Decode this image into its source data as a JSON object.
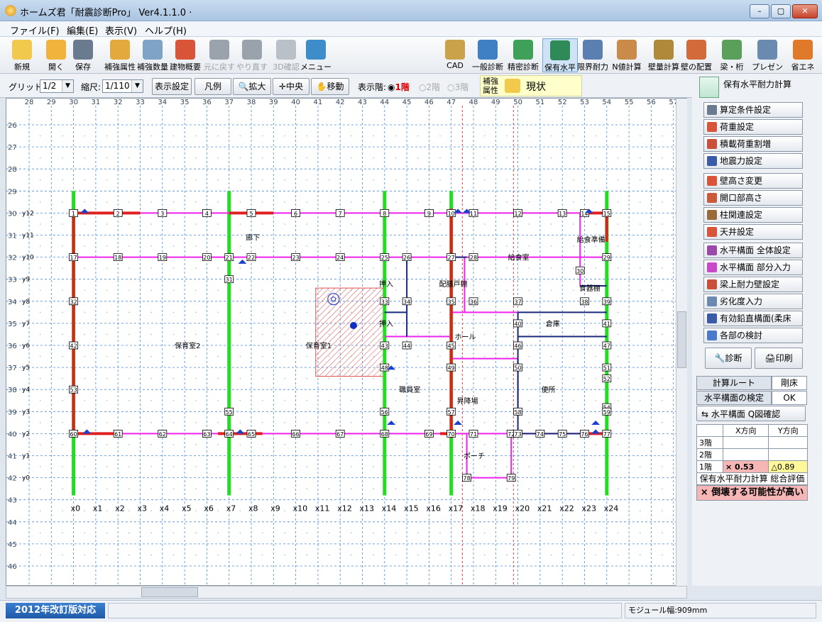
{
  "window": {
    "title": "ホームズ君「耐震診断Pro」 Ver4.1.1.0 ·",
    "controls": [
      "–",
      "▢",
      "✕"
    ]
  },
  "menu": [
    "ファイル(F)",
    "編集(E)",
    "表示(V)",
    "ヘルプ(H)"
  ],
  "toolbar_left": [
    {
      "label": "新規",
      "icon": "new-icon",
      "color": "#f2c94c"
    },
    {
      "label": "開く",
      "icon": "open-folder-icon",
      "color": "#f0b43c"
    },
    {
      "label": "保存",
      "icon": "save-icon",
      "color": "#6b7b8f"
    },
    {
      "label": "補強属性",
      "icon": "reinforce-attr-icon",
      "color": "#e4a93c"
    },
    {
      "label": "補強数量",
      "icon": "calculator-icon",
      "color": "#7fa3c4"
    },
    {
      "label": "建物概要",
      "icon": "house-icon",
      "color": "#d8553a"
    },
    {
      "label": "元に戻す",
      "icon": "undo-icon",
      "color": "#9aa2ab",
      "disabled": true
    },
    {
      "label": "やり直す",
      "icon": "redo-icon",
      "color": "#9aa2ab",
      "disabled": true
    },
    {
      "label": "3D確認",
      "icon": "3d-icon",
      "color": "#b9c0c8",
      "disabled": true
    },
    {
      "label": "メニュー",
      "icon": "menu-door-icon",
      "color": "#3c8dc9"
    }
  ],
  "toolbar_right": [
    {
      "label": "CAD",
      "icon": "cad-icon",
      "color": "#c9a24a"
    },
    {
      "label": "一般診断",
      "icon": "general-diag-icon",
      "color": "#3f7fc4"
    },
    {
      "label": "精密診断",
      "icon": "precise-diag-icon",
      "color": "#3fa05a"
    },
    {
      "label": "保有水平",
      "icon": "horizontal-capacity-icon",
      "color": "#2e8b57",
      "active": true
    },
    {
      "label": "限界耐力",
      "icon": "limit-strength-icon",
      "color": "#5a7fb0"
    },
    {
      "label": "N値計算",
      "icon": "n-value-icon",
      "color": "#c98a4a"
    },
    {
      "label": "壁量計算",
      "icon": "wall-amount-icon",
      "color": "#b08a3a"
    },
    {
      "label": "壁の配置",
      "icon": "wall-layout-icon",
      "color": "#d26a3a"
    },
    {
      "label": "梁・桁",
      "icon": "beam-icon",
      "color": "#5aa05a"
    },
    {
      "label": "プレゼン",
      "icon": "presentation-icon",
      "color": "#6a8ab0"
    },
    {
      "label": "省エネ",
      "icon": "energy-icon",
      "color": "#e07a2a"
    }
  ],
  "toolbar2": {
    "grid_label": "グリッド:",
    "grid_value": "1/2",
    "scale_label": "縮尺:",
    "scale_value": "1/110",
    "display_settings": "表示設定",
    "legend": "凡例",
    "zoom": "拡大",
    "center": "中央",
    "move": "移動",
    "floor_label": "表示階:",
    "floors": [
      "1階",
      "2階",
      "3階"
    ],
    "attr_label": "補強属性",
    "attr_value": "現状"
  },
  "grid": {
    "top_numbers": [
      "28",
      "29",
      "30",
      "31",
      "32",
      "33",
      "34",
      "35",
      "36",
      "37",
      "38",
      "39",
      "40",
      "41",
      "42",
      "43",
      "44",
      "45",
      "46",
      "47",
      "48",
      "49",
      "50",
      "51",
      "52",
      "53",
      "54",
      "55",
      "56",
      "57"
    ],
    "left_numbers": [
      "26",
      "27",
      "28",
      "29",
      "30",
      "31",
      "32",
      "33",
      "34",
      "35",
      "36",
      "37",
      "38",
      "39",
      "40",
      "41",
      "42",
      "43",
      "44",
      "45",
      "46"
    ],
    "x_labels": [
      "x0",
      "x1",
      "x2",
      "x3",
      "x4",
      "x5",
      "x6",
      "x7",
      "x8",
      "x9",
      "x10",
      "x11",
      "x12",
      "x13",
      "x14",
      "x15",
      "x16",
      "x17",
      "x18",
      "x19",
      "x20",
      "x21",
      "x22",
      "x23",
      "x24"
    ],
    "y_labels": [
      "y12",
      "y11",
      "y10",
      "y9",
      "y8",
      "y7",
      "y6",
      "y5",
      "y4",
      "y3",
      "y2",
      "y1",
      "y0"
    ]
  },
  "rooms": [
    "廊下",
    "給食室",
    "給食準備",
    "押入",
    "配膳戸棚",
    "食器棚",
    "倉庫",
    "ホール",
    "保育室2",
    "保育室1",
    "押入",
    "職員室",
    "便所",
    "昇降場",
    "ポーチ"
  ],
  "panel": {
    "title": "保有水平耐力計算",
    "buttons": [
      "算定条件設定",
      "荷重設定",
      "積載荷重割増",
      "地震力設定",
      "壁高さ変更",
      "開口部高さ",
      "柱関連設定",
      "天井設定",
      "水平構面 全体設定",
      "水平構面 部分入力",
      "梁上耐力壁設定",
      "劣化度入力",
      "有効鉛直構面(柔床用)",
      "各部の検討"
    ],
    "diagnose": "診断",
    "print": "印刷",
    "calc_route_label": "計算ルート",
    "calc_route_value": "剛床",
    "horiz_check_label": "水平構面の検定",
    "horiz_check_value": "OK",
    "q_confirm": "水平構面 Q図確認",
    "table_headers": [
      "",
      "X方向",
      "Y方向"
    ],
    "table_rows": [
      [
        "3階",
        "",
        ""
      ],
      [
        "2階",
        "",
        ""
      ],
      [
        "1階",
        "× 0.53",
        "△0.89"
      ]
    ],
    "eval_title": "保有水平耐力計算 総合評価",
    "eval_result": "× 倒壊する可能性が高い"
  },
  "status": {
    "badge": "2012年改訂版対応",
    "module": "モジュール幅:909mm"
  }
}
